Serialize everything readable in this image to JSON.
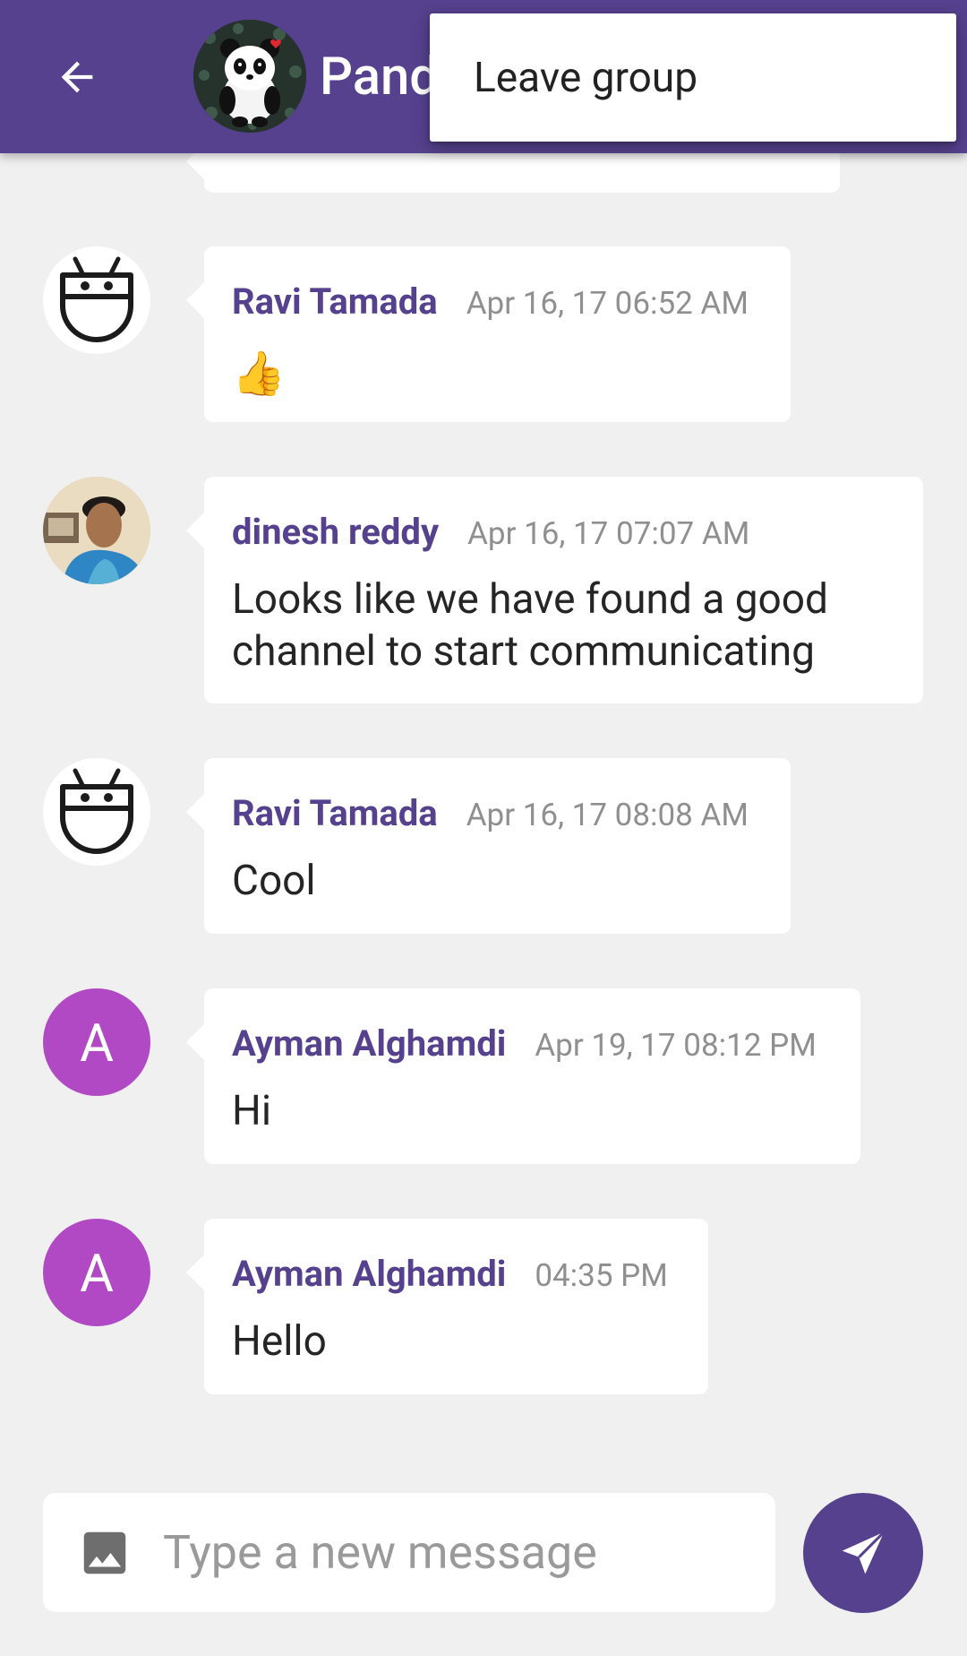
{
  "toolbar": {
    "group_name": "Panda",
    "back_icon": "arrow-back-icon",
    "group_avatar_icon": "panda-avatar-icon",
    "background_color": "#55418d"
  },
  "menu": {
    "items": [
      {
        "label": "Leave group"
      }
    ]
  },
  "messages": [
    {
      "author": "Ravi Tamada",
      "time": "Apr 16, 17 06:52 AM",
      "text": "👍",
      "avatar": "robot-face-icon"
    },
    {
      "author": "dinesh reddy",
      "time": "Apr 16, 17 07:07 AM",
      "text": "Looks like we have found a good channel to start communicating",
      "avatar": "user-photo"
    },
    {
      "author": "Ravi Tamada",
      "time": "Apr 16, 17 08:08 AM",
      "text": "Cool",
      "avatar": "robot-face-icon"
    },
    {
      "author": "Ayman Alghamdi",
      "time": "Apr 19, 17 08:12 PM",
      "text": "Hi",
      "avatar_letter": "A",
      "avatar_color": "#b148c4"
    },
    {
      "author": "Ayman Alghamdi",
      "time": "04:35 PM",
      "text": "Hello",
      "avatar_letter": "A",
      "avatar_color": "#b148c4"
    }
  ],
  "compose": {
    "placeholder": "Type a new message",
    "attach_icon": "image-icon",
    "send_icon": "send-icon"
  },
  "colors": {
    "accent": "#55418d",
    "chat_background": "#f0f0f0",
    "author_name": "#55418d",
    "timestamp": "#8f8f8f"
  }
}
